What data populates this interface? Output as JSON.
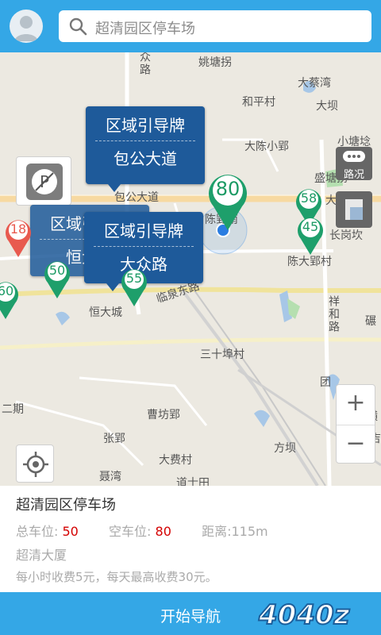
{
  "search": {
    "placeholder": "超清园区停车场"
  },
  "map": {
    "labels": [
      "众路",
      "姚塘拐",
      "大蔡湾",
      "和平村",
      "大坝",
      "大陈小郢",
      "小塘埝",
      "盛塘拐",
      "包公大道",
      "大道",
      "陈郢南",
      "长岗坎",
      "陈大郢村",
      "恒大城",
      "临泉东路",
      "祥和路",
      "碾",
      "三十埠村",
      "团",
      "二期",
      "曹坊郢",
      "张郢",
      "方坝",
      "大费村",
      "聂湾",
      "道士田",
      "横",
      "横吉"
    ],
    "callouts": [
      {
        "line1": "区域引导牌",
        "line2": "包公大道"
      },
      {
        "line1": "区域引导牌",
        "line2": "恒大城"
      },
      {
        "line1": "区域引导牌",
        "line2": "大众路"
      }
    ],
    "pins": [
      "80",
      "58",
      "45",
      "18",
      "50",
      "55",
      "60"
    ],
    "road_button": "路况",
    "zoom_in": "+",
    "zoom_out": "−",
    "icons": [
      "parking-icon",
      "locate-icon",
      "layers-icon",
      "traffic-icon"
    ]
  },
  "info": {
    "name": "超清园区停车场",
    "total_label": "总车位:",
    "total_value": "50",
    "free_label": "空车位:",
    "free_value": "80",
    "distance": "距离:115m",
    "address": "超清大厦",
    "fee": "每小时收费5元，每天最高收费30元。"
  },
  "nav_button": "开始导航",
  "watermark": "4040z"
}
